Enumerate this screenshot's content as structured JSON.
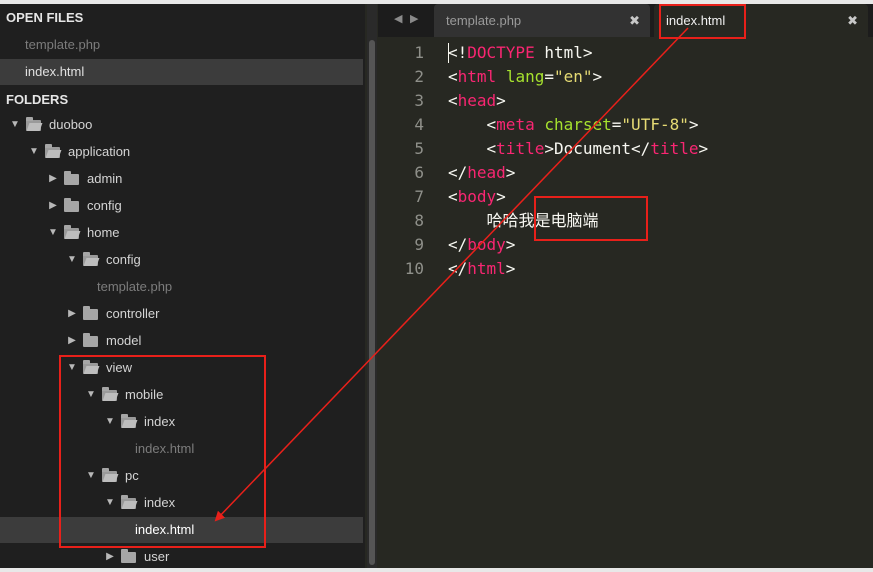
{
  "sidebar": {
    "open_files_title": "OPEN FILES",
    "open_files": [
      {
        "label": "template.php",
        "active": false
      },
      {
        "label": "index.html",
        "active": true
      }
    ],
    "folders_title": "FOLDERS",
    "tree": [
      {
        "label": "duoboo",
        "type": "folder",
        "expanded": true,
        "depth": 0
      },
      {
        "label": "application",
        "type": "folder",
        "expanded": true,
        "depth": 1
      },
      {
        "label": "admin",
        "type": "folder",
        "expanded": false,
        "depth": 2
      },
      {
        "label": "config",
        "type": "folder",
        "expanded": false,
        "depth": 2
      },
      {
        "label": "home",
        "type": "folder",
        "expanded": true,
        "depth": 2
      },
      {
        "label": "config",
        "type": "folder",
        "expanded": true,
        "depth": 3
      },
      {
        "label": "template.php",
        "type": "file",
        "depth": 4
      },
      {
        "label": "controller",
        "type": "folder",
        "expanded": false,
        "depth": 3
      },
      {
        "label": "model",
        "type": "folder",
        "expanded": false,
        "depth": 3
      },
      {
        "label": "view",
        "type": "folder",
        "expanded": true,
        "depth": 3
      },
      {
        "label": "mobile",
        "type": "folder",
        "expanded": true,
        "depth": 4
      },
      {
        "label": "index",
        "type": "folder",
        "expanded": true,
        "depth": 5
      },
      {
        "label": "index.html",
        "type": "file",
        "depth": 6
      },
      {
        "label": "pc",
        "type": "folder",
        "expanded": true,
        "depth": 4
      },
      {
        "label": "index",
        "type": "folder",
        "expanded": true,
        "depth": 5
      },
      {
        "label": "index.html",
        "type": "file",
        "depth": 6,
        "selected": true
      },
      {
        "label": "user",
        "type": "folder",
        "expanded": false,
        "depth": 5
      }
    ]
  },
  "tabs": {
    "prev_icon": "◀",
    "next_icon": "▶",
    "items": [
      {
        "label": "template.php",
        "active": false,
        "close": "✖"
      },
      {
        "label": "index.html",
        "active": true,
        "close": "✖"
      }
    ]
  },
  "editor": {
    "line_numbers": [
      "1",
      "2",
      "3",
      "4",
      "5",
      "6",
      "7",
      "8",
      "9",
      "10"
    ],
    "lines": [
      [
        {
          "t": "&lt;!"
        },
        {
          "t": "DOCTYPE",
          "c": "t"
        },
        {
          "t": " html&gt;"
        }
      ],
      [
        {
          "t": "&lt;"
        },
        {
          "t": "html",
          "c": "t"
        },
        {
          "t": " "
        },
        {
          "t": "lang",
          "c": "a"
        },
        {
          "t": "="
        },
        {
          "t": "\"en\"",
          "c": "s"
        },
        {
          "t": "&gt;"
        }
      ],
      [
        {
          "t": "&lt;"
        },
        {
          "t": "head",
          "c": "t"
        },
        {
          "t": "&gt;"
        }
      ],
      [
        {
          "t": "    &lt;"
        },
        {
          "t": "meta",
          "c": "t"
        },
        {
          "t": " "
        },
        {
          "t": "charset",
          "c": "a"
        },
        {
          "t": "="
        },
        {
          "t": "\"UTF-8\"",
          "c": "s"
        },
        {
          "t": "&gt;"
        }
      ],
      [
        {
          "t": "    &lt;"
        },
        {
          "t": "title",
          "c": "t"
        },
        {
          "t": "&gt;Document&lt;/"
        },
        {
          "t": "title",
          "c": "t"
        },
        {
          "t": "&gt;"
        }
      ],
      [
        {
          "t": "&lt;/"
        },
        {
          "t": "head",
          "c": "t"
        },
        {
          "t": "&gt;"
        }
      ],
      [
        {
          "t": "&lt;"
        },
        {
          "t": "body",
          "c": "t"
        },
        {
          "t": "&gt;"
        }
      ],
      [
        {
          "t": "    哈哈我是电脑端"
        }
      ],
      [
        {
          "t": "&lt;/"
        },
        {
          "t": "body",
          "c": "t"
        },
        {
          "t": "&gt;"
        }
      ],
      [
        {
          "t": "&lt;/"
        },
        {
          "t": "html",
          "c": "t"
        },
        {
          "t": "&gt;"
        }
      ]
    ]
  },
  "annotation_color": "#e8201a"
}
